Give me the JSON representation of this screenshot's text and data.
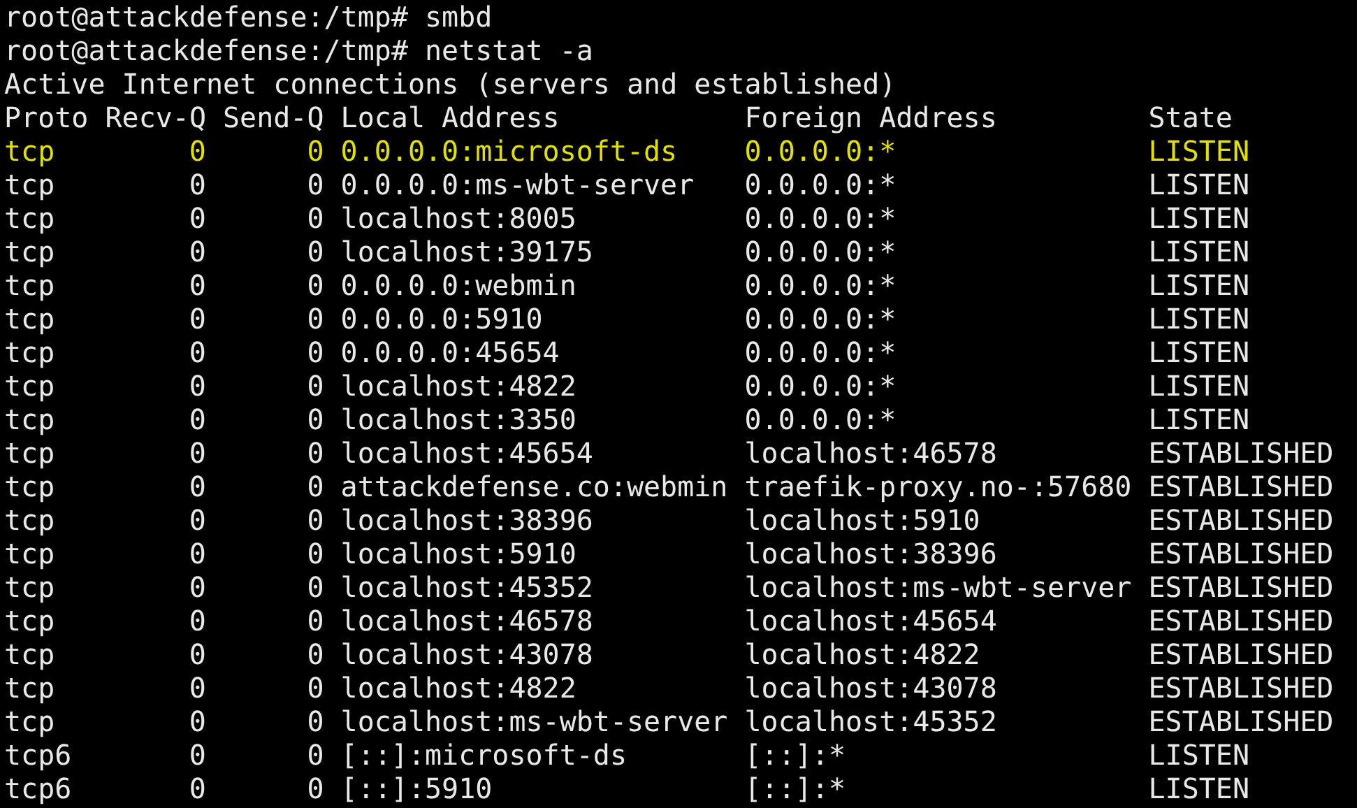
{
  "commands": [
    {
      "prompt": "root@attackdefense:/tmp#",
      "command": "smbd"
    },
    {
      "prompt": "root@attackdefense:/tmp#",
      "command": "netstat -a"
    }
  ],
  "output_title": "Active Internet connections (servers and established)",
  "table": {
    "columns": [
      "Proto",
      "Recv-Q",
      "Send-Q",
      "Local Address",
      "Foreign Address",
      "State"
    ],
    "rows": [
      {
        "proto": "tcp",
        "recv_q": "0",
        "send_q": "0",
        "local": "0.0.0.0:microsoft-ds",
        "foreign": "0.0.0.0:*",
        "state": "LISTEN",
        "highlighted": true
      },
      {
        "proto": "tcp",
        "recv_q": "0",
        "send_q": "0",
        "local": "0.0.0.0:ms-wbt-server",
        "foreign": "0.0.0.0:*",
        "state": "LISTEN",
        "highlighted": false
      },
      {
        "proto": "tcp",
        "recv_q": "0",
        "send_q": "0",
        "local": "localhost:8005",
        "foreign": "0.0.0.0:*",
        "state": "LISTEN",
        "highlighted": false
      },
      {
        "proto": "tcp",
        "recv_q": "0",
        "send_q": "0",
        "local": "localhost:39175",
        "foreign": "0.0.0.0:*",
        "state": "LISTEN",
        "highlighted": false
      },
      {
        "proto": "tcp",
        "recv_q": "0",
        "send_q": "0",
        "local": "0.0.0.0:webmin",
        "foreign": "0.0.0.0:*",
        "state": "LISTEN",
        "highlighted": false
      },
      {
        "proto": "tcp",
        "recv_q": "0",
        "send_q": "0",
        "local": "0.0.0.0:5910",
        "foreign": "0.0.0.0:*",
        "state": "LISTEN",
        "highlighted": false
      },
      {
        "proto": "tcp",
        "recv_q": "0",
        "send_q": "0",
        "local": "0.0.0.0:45654",
        "foreign": "0.0.0.0:*",
        "state": "LISTEN",
        "highlighted": false
      },
      {
        "proto": "tcp",
        "recv_q": "0",
        "send_q": "0",
        "local": "localhost:4822",
        "foreign": "0.0.0.0:*",
        "state": "LISTEN",
        "highlighted": false
      },
      {
        "proto": "tcp",
        "recv_q": "0",
        "send_q": "0",
        "local": "localhost:3350",
        "foreign": "0.0.0.0:*",
        "state": "LISTEN",
        "highlighted": false
      },
      {
        "proto": "tcp",
        "recv_q": "0",
        "send_q": "0",
        "local": "localhost:45654",
        "foreign": "localhost:46578",
        "state": "ESTABLISHED",
        "highlighted": false
      },
      {
        "proto": "tcp",
        "recv_q": "0",
        "send_q": "0",
        "local": "attackdefense.co:webmin",
        "foreign": "traefik-proxy.no-:57680",
        "state": "ESTABLISHED",
        "highlighted": false
      },
      {
        "proto": "tcp",
        "recv_q": "0",
        "send_q": "0",
        "local": "localhost:38396",
        "foreign": "localhost:5910",
        "state": "ESTABLISHED",
        "highlighted": false
      },
      {
        "proto": "tcp",
        "recv_q": "0",
        "send_q": "0",
        "local": "localhost:5910",
        "foreign": "localhost:38396",
        "state": "ESTABLISHED",
        "highlighted": false
      },
      {
        "proto": "tcp",
        "recv_q": "0",
        "send_q": "0",
        "local": "localhost:45352",
        "foreign": "localhost:ms-wbt-server",
        "state": "ESTABLISHED",
        "highlighted": false
      },
      {
        "proto": "tcp",
        "recv_q": "0",
        "send_q": "0",
        "local": "localhost:46578",
        "foreign": "localhost:45654",
        "state": "ESTABLISHED",
        "highlighted": false
      },
      {
        "proto": "tcp",
        "recv_q": "0",
        "send_q": "0",
        "local": "localhost:43078",
        "foreign": "localhost:4822",
        "state": "ESTABLISHED",
        "highlighted": false
      },
      {
        "proto": "tcp",
        "recv_q": "0",
        "send_q": "0",
        "local": "localhost:4822",
        "foreign": "localhost:43078",
        "state": "ESTABLISHED",
        "highlighted": false
      },
      {
        "proto": "tcp",
        "recv_q": "0",
        "send_q": "0",
        "local": "localhost:ms-wbt-server",
        "foreign": "localhost:45352",
        "state": "ESTABLISHED",
        "highlighted": false
      },
      {
        "proto": "tcp6",
        "recv_q": "0",
        "send_q": "0",
        "local": "[::]:microsoft-ds",
        "foreign": "[::]:*",
        "state": "LISTEN",
        "highlighted": false
      },
      {
        "proto": "tcp6",
        "recv_q": "0",
        "send_q": "0",
        "local": "[::]:5910",
        "foreign": "[::]:*",
        "state": "LISTEN",
        "highlighted": false
      }
    ]
  }
}
